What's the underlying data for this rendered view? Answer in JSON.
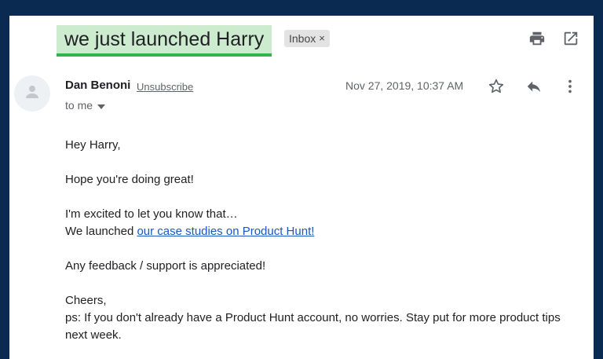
{
  "email": {
    "subject": "we just launched Harry",
    "label_chip": "Inbox",
    "label_chip_close": "×",
    "sender_name": "Dan Benoni",
    "unsubscribe": "Unsubscribe",
    "recipient": "to me",
    "date": "Nov 27, 2019, 10:37 AM",
    "body": {
      "greeting": "Hey Harry,",
      "line1": "Hope you're doing great!",
      "line2": "I'm excited to let you know that…",
      "line3_prefix": "We launched ",
      "line3_link": "our case studies on Product Hunt!",
      "line4": "Any feedback / support is appreciated!",
      "signoff": "Cheers,",
      "ps": "ps: If you don't already have a Product Hunt account, no worries. Stay put for more product tips next week."
    }
  },
  "icons": {
    "print": "print-icon",
    "open_new": "open-in-new-window-icon",
    "star": "star-icon",
    "reply": "reply-icon",
    "more": "more-vertical-icon",
    "avatar": "person-icon",
    "dropdown": "chevron-down-icon"
  },
  "colors": {
    "frame_background": "#0b2a52",
    "subject_highlight": "#cdeccf",
    "subject_underline": "#35b34a",
    "link": "#1a56c4"
  }
}
